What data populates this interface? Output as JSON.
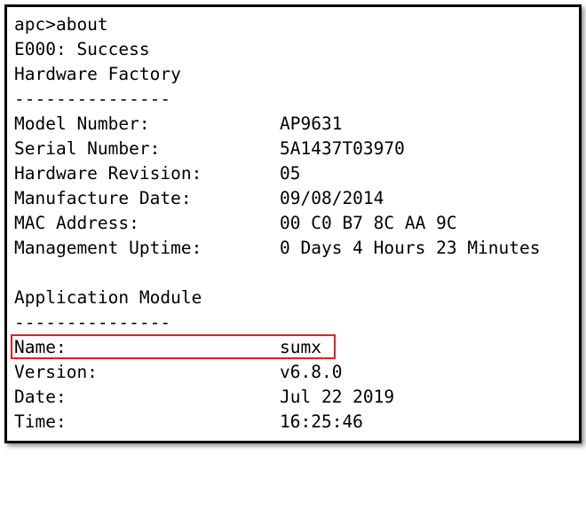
{
  "prompt_line": "apc>about",
  "status_line": "E000: Success",
  "hardware_section": {
    "title": "Hardware Factory",
    "separator": "---------------",
    "rows": [
      {
        "label": "Model Number:",
        "value": "AP9631"
      },
      {
        "label": "Serial Number:",
        "value": "5A1437T03970"
      },
      {
        "label": "Hardware Revision:",
        "value": "05"
      },
      {
        "label": "Manufacture Date:",
        "value": "09/08/2014"
      },
      {
        "label": "MAC Address:",
        "value": "00 C0 B7 8C AA 9C"
      },
      {
        "label": "Management Uptime:",
        "value": "0 Days 4 Hours 23 Minutes"
      }
    ]
  },
  "application_section": {
    "title": "Application Module",
    "separator": "---------------",
    "rows": [
      {
        "label": "Name:",
        "value": "sumx"
      },
      {
        "label": "Version:",
        "value": "v6.8.0"
      },
      {
        "label": "Date:",
        "value": "Jul 22 2019"
      },
      {
        "label": "Time:",
        "value": "16:25:46"
      }
    ]
  },
  "highlight_color": "#e02020"
}
